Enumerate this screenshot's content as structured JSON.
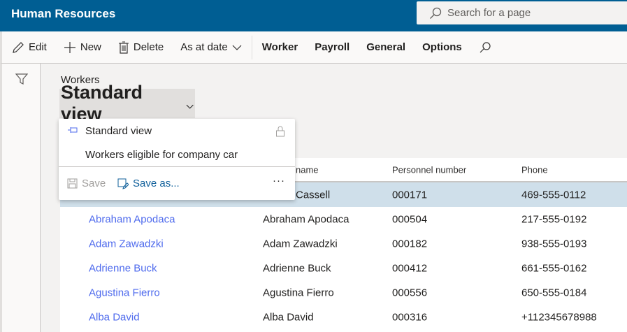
{
  "app": {
    "title": "Human Resources",
    "search_placeholder": "Search for a page"
  },
  "toolbar": {
    "edit": "Edit",
    "new": "New",
    "delete": "Delete",
    "as_at_date": "As at date",
    "worker": "Worker",
    "payroll": "Payroll",
    "general": "General",
    "options": "Options"
  },
  "page": {
    "breadcrumb": "Workers",
    "view_title": "Standard view"
  },
  "view_menu": {
    "items": [
      "Standard view",
      "Workers eligible for company car"
    ],
    "save": "Save",
    "save_as": "Save as...",
    "more": "···"
  },
  "grid": {
    "headers": [
      "name",
      "Personnel number",
      "Phone"
    ],
    "rows": [
      {
        "name": "",
        "full": "Cassell",
        "number": "000171",
        "phone": "469-555-0112"
      },
      {
        "name": "Abraham Apodaca",
        "full": "Abraham Apodaca",
        "number": "000504",
        "phone": "217-555-0192"
      },
      {
        "name": "Adam Zawadzki",
        "full": "Adam Zawadzki",
        "number": "000182",
        "phone": "938-555-0193"
      },
      {
        "name": "Adrienne Buck",
        "full": "Adrienne Buck",
        "number": "000412",
        "phone": "661-555-0162"
      },
      {
        "name": "Agustina Fierro",
        "full": "Agustina Fierro",
        "number": "000556",
        "phone": "650-555-0184"
      },
      {
        "name": "Alba David",
        "full": "Alba David",
        "number": "000316",
        "phone": "+112345678988"
      }
    ]
  }
}
